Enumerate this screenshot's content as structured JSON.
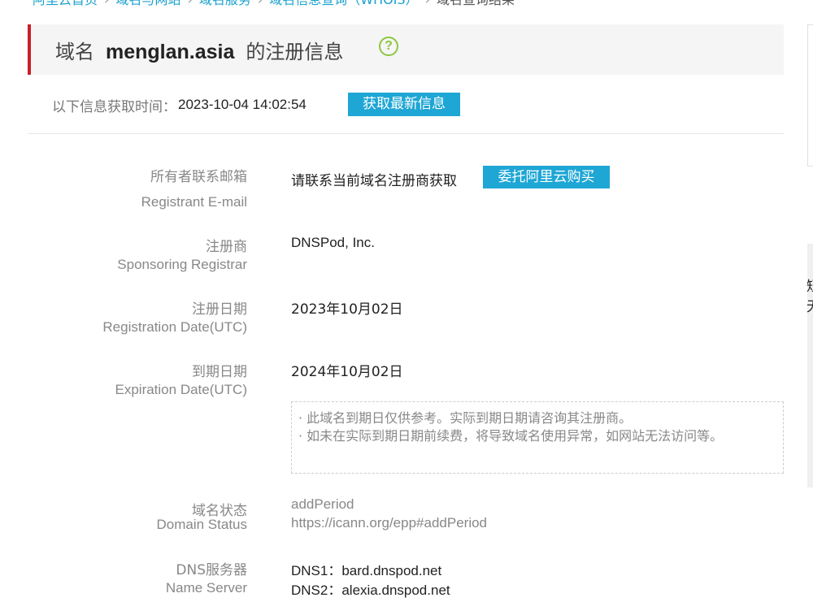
{
  "breadcrumb": {
    "items": [
      "阿里云首页",
      "域名与网站",
      "域名服务",
      "域名信息查询（WHOIS）"
    ],
    "current": "域名查询结果"
  },
  "header": {
    "prefix": "域名",
    "domain": "menglan.asia",
    "suffix": "的注册信息",
    "help_glyph": "?"
  },
  "fetch": {
    "label": "以下信息获取时间：",
    "time": "2023-10-04 14:02:54",
    "button": "获取最新信息"
  },
  "fields": {
    "email": {
      "label_cn": "所有者联系邮箱",
      "label_en": "Registrant E-mail",
      "value": "请联系当前域名注册商获取",
      "button": "委托阿里云购买"
    },
    "registrar": {
      "label_cn": "注册商",
      "label_en": "Sponsoring Registrar",
      "value": "DNSPod, Inc."
    },
    "reg_date": {
      "label_cn": "注册日期",
      "label_en": "Registration Date(UTC)",
      "value": "2023年10月02日"
    },
    "exp_date": {
      "label_cn": "到期日期",
      "label_en": "Expiration Date(UTC)",
      "value": "2024年10月02日"
    },
    "status": {
      "label_cn": "域名状态",
      "label_en": "Domain Status",
      "value": "addPeriod",
      "link": "https://icann.org/epp#addPeriod"
    },
    "dns": {
      "label_cn": "DNS服务器",
      "label_en": "Name Server",
      "ns1": "DNS1：bard.dnspod.net",
      "ns2": "DNS2：alexia.dnspod.net"
    }
  },
  "notice": {
    "line1": "· 此域名到期日仅供参考。实际到期日期请咨询其注册商。",
    "line2": "· 如未在实际到期日期前续费，将导致域名使用异常，如网站无法访问等。"
  },
  "edge_chars": [
    "短",
    "无"
  ],
  "colors": {
    "accent": "#1ea6d5",
    "title_bar_border": "#c8202a",
    "help_icon": "#8cc63f"
  }
}
